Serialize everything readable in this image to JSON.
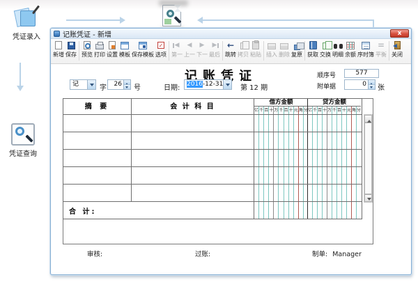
{
  "workflow": {
    "entry_label": "凭证录入",
    "query_label": "凭证查询"
  },
  "window": {
    "title": "记账凭证 - 新增",
    "close_glyph": "x"
  },
  "toolbar": {
    "groups": [
      [
        {
          "name": "new",
          "label": "新增",
          "icon": "new-document-icon",
          "enabled": true
        },
        {
          "name": "save",
          "label": "保存",
          "icon": "save-icon",
          "enabled": true
        }
      ],
      [
        {
          "name": "preview",
          "label": "预览",
          "icon": "print-preview-icon",
          "enabled": true
        },
        {
          "name": "print",
          "label": "打印",
          "icon": "printer-icon",
          "enabled": true
        },
        {
          "name": "settings",
          "label": "设置",
          "icon": "page-setup-icon",
          "enabled": true
        },
        {
          "name": "template",
          "label": "模板",
          "icon": "template-icon",
          "enabled": true
        },
        {
          "name": "save-template",
          "label": "保存模板",
          "icon": "save-template-icon",
          "enabled": true
        },
        {
          "name": "options",
          "label": "选项",
          "icon": "options-icon",
          "enabled": true
        }
      ],
      [
        {
          "name": "first",
          "label": "第一",
          "icon": "first-record-icon",
          "enabled": false
        },
        {
          "name": "prev",
          "label": "上一",
          "icon": "previous-record-icon",
          "enabled": false
        },
        {
          "name": "next",
          "label": "下一",
          "icon": "next-record-icon",
          "enabled": false
        },
        {
          "name": "last",
          "label": "最后",
          "icon": "last-record-icon",
          "enabled": false
        }
      ],
      [
        {
          "name": "jump",
          "label": "跳转",
          "icon": "jump-icon",
          "enabled": true
        },
        {
          "name": "copy",
          "label": "拷贝",
          "icon": "copy-icon",
          "enabled": false
        },
        {
          "name": "paste",
          "label": "粘贴",
          "icon": "paste-icon",
          "enabled": false
        }
      ],
      [
        {
          "name": "insert",
          "label": "插入",
          "icon": "insert-row-icon",
          "enabled": false
        },
        {
          "name": "delete",
          "label": "删除",
          "icon": "delete-row-icon",
          "enabled": false
        },
        {
          "name": "restore",
          "label": "复原",
          "icon": "restore-icon",
          "enabled": true
        }
      ],
      [
        {
          "name": "fetch",
          "label": "获取",
          "icon": "fetch-icon",
          "enabled": true
        },
        {
          "name": "swap",
          "label": "交换",
          "icon": "swap-icon",
          "enabled": true
        },
        {
          "name": "detail",
          "label": "明细",
          "icon": "detail-binoculars-icon",
          "enabled": true
        },
        {
          "name": "balance",
          "label": "余额",
          "icon": "balance-table-icon",
          "enabled": true
        },
        {
          "name": "journal",
          "label": "序时簿",
          "icon": "journal-icon",
          "enabled": true
        },
        {
          "name": "equal",
          "label": "平衡",
          "icon": "equal-icon",
          "enabled": false
        }
      ],
      [
        {
          "name": "close",
          "label": "关闭",
          "icon": "close-window-icon",
          "enabled": true
        }
      ]
    ]
  },
  "voucher": {
    "title": "记账凭证",
    "seq_label": "顺序号",
    "seq_value": "577",
    "word_value": "记",
    "word_suffix": "字",
    "number_value": "26",
    "number_suffix": "号",
    "date_label": "日期:",
    "date_year": "2016",
    "date_rest": "-12-31",
    "period_text": "第 12 期",
    "attach_label": "附单据",
    "attach_value": "0",
    "attach_suffix": "张",
    "table": {
      "summary_header": "摘 要",
      "account_header": "会 计 科 目",
      "debit_header": "借方金额",
      "credit_header": "贷方金额",
      "digit_labels": [
        "亿",
        "千",
        "百",
        "十",
        "万",
        "千",
        "百",
        "十",
        "元",
        "角",
        "分"
      ],
      "empty_row_count": 5,
      "total_label": "合 计:"
    },
    "footer": {
      "audit_label": "审核:",
      "post_label": "过账:",
      "prepare_label": "制单:",
      "preparer": "Manager"
    }
  },
  "colors": {
    "window_border": "#86aed3",
    "selection_blue": "#3399ff",
    "grid_teal": "#7cc7c0",
    "grid_red": "#b05a52",
    "grid_dark": "#6e6e6e",
    "close_button_red": "#d8503f",
    "arrow_blue": "#bad3e8"
  }
}
